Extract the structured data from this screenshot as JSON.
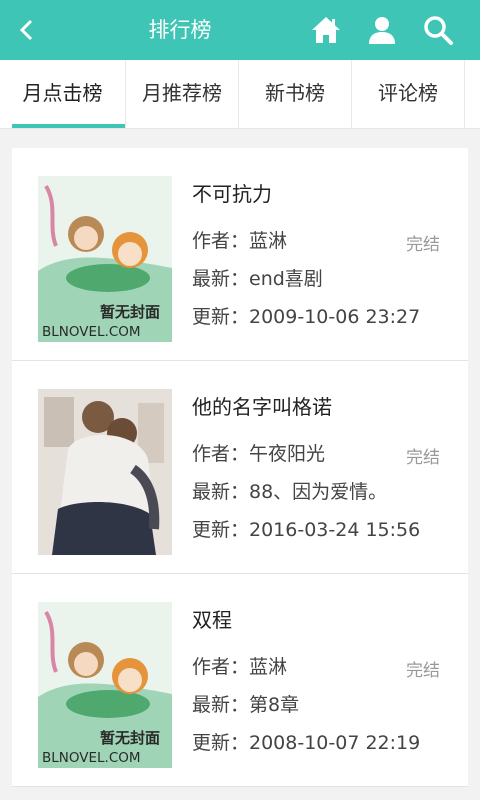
{
  "header": {
    "title": "排行榜",
    "icons": [
      "back-icon",
      "home-icon",
      "user-icon",
      "search-icon"
    ],
    "accent": "#3ec5b5"
  },
  "tabs": [
    {
      "label": "月点击榜",
      "active": true
    },
    {
      "label": "月推荐榜",
      "active": false
    },
    {
      "label": "新书榜",
      "active": false
    },
    {
      "label": "评论榜",
      "active": false
    }
  ],
  "books": [
    {
      "title": "不可抗力",
      "author": "作者：蓝淋",
      "status": "完结",
      "latest": "最新：end喜剧",
      "updated": "更新：2009-10-06 23:27",
      "cover": {
        "placeholder": "暂无封面",
        "site": "BLNOVEL.COM"
      }
    },
    {
      "title": "他的名字叫格诺",
      "author": "作者：午夜阳光",
      "status": "完结",
      "latest": "最新：88、因为爱情。",
      "updated": "更新：2016-03-24 15:56"
    },
    {
      "title": "双程",
      "author": "作者：蓝淋",
      "status": "完结",
      "latest": "最新：第8章",
      "updated": "更新：2008-10-07 22:19",
      "cover": {
        "placeholder": "暂无封面",
        "site": "BLNOVEL.COM"
      }
    }
  ]
}
